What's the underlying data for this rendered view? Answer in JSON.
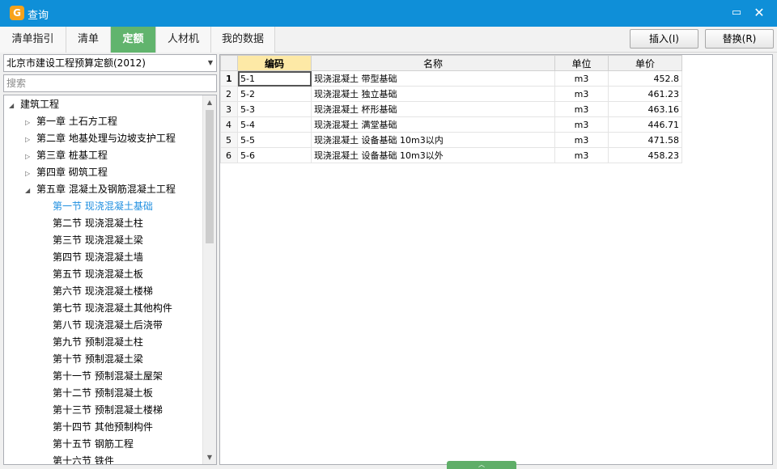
{
  "window": {
    "app_icon_glyph": "G",
    "title": "查询",
    "maximize_glyph": "▭",
    "close_glyph": "✕",
    "accent_color": "#0f8fd8",
    "active_tab_color": "#61b46d"
  },
  "tabs": [
    {
      "label": "清单指引"
    },
    {
      "label": "清单"
    },
    {
      "label": "定额"
    },
    {
      "label": "人材机"
    },
    {
      "label": "我的数据"
    }
  ],
  "actions": {
    "insert_label": "插入(I)",
    "replace_label": "替换(R)"
  },
  "left": {
    "library_select": "北京市建设工程预算定额(2012)",
    "search_placeholder": "搜索",
    "tree": [
      {
        "label": "建筑工程",
        "toggle": "◢"
      },
      {
        "label": "第一章 土石方工程",
        "toggle": "▷"
      },
      {
        "label": "第二章 地基处理与边坡支护工程",
        "toggle": "▷"
      },
      {
        "label": "第三章 桩基工程",
        "toggle": "▷"
      },
      {
        "label": "第四章 砌筑工程",
        "toggle": "▷"
      },
      {
        "label": "第五章 混凝土及钢筋混凝土工程",
        "toggle": "◢"
      },
      {
        "label": "第一节 现浇混凝土基础"
      },
      {
        "label": "第二节 现浇混凝土柱"
      },
      {
        "label": "第三节 现浇混凝土梁"
      },
      {
        "label": "第四节 现浇混凝土墙"
      },
      {
        "label": "第五节 现浇混凝土板"
      },
      {
        "label": "第六节 现浇混凝土楼梯"
      },
      {
        "label": "第七节 现浇混凝土其他构件"
      },
      {
        "label": "第八节 现浇混凝土后浇带"
      },
      {
        "label": "第九节 预制混凝土柱"
      },
      {
        "label": "第十节 预制混凝土梁"
      },
      {
        "label": "第十一节 预制混凝土屋架"
      },
      {
        "label": "第十二节 预制混凝土板"
      },
      {
        "label": "第十三节 预制混凝土楼梯"
      },
      {
        "label": "第十四节 其他预制构件"
      },
      {
        "label": "第十五节 钢筋工程"
      },
      {
        "label": "第十六节 铁件"
      }
    ],
    "scroll_up_glyph": "▲",
    "scroll_down_glyph": "▼"
  },
  "table": {
    "columns": [
      "编码",
      "名称",
      "单位",
      "单价"
    ],
    "rows": [
      {
        "num": "1",
        "code": "5-1",
        "name": "现浇混凝土 带型基础",
        "unit": "m3",
        "price": "452.8"
      },
      {
        "num": "2",
        "code": "5-2",
        "name": "现浇混凝土 独立基础",
        "unit": "m3",
        "price": "461.23"
      },
      {
        "num": "3",
        "code": "5-3",
        "name": "现浇混凝土 杯形基础",
        "unit": "m3",
        "price": "463.16"
      },
      {
        "num": "4",
        "code": "5-4",
        "name": "现浇混凝土 满堂基础",
        "unit": "m3",
        "price": "446.71"
      },
      {
        "num": "5",
        "code": "5-5",
        "name": "现浇混凝土 设备基础 10m3以内",
        "unit": "m3",
        "price": "471.58"
      },
      {
        "num": "6",
        "code": "5-6",
        "name": "现浇混凝土 设备基础 10m3以外",
        "unit": "m3",
        "price": "458.23"
      }
    ]
  },
  "splitter_glyph": "︿"
}
